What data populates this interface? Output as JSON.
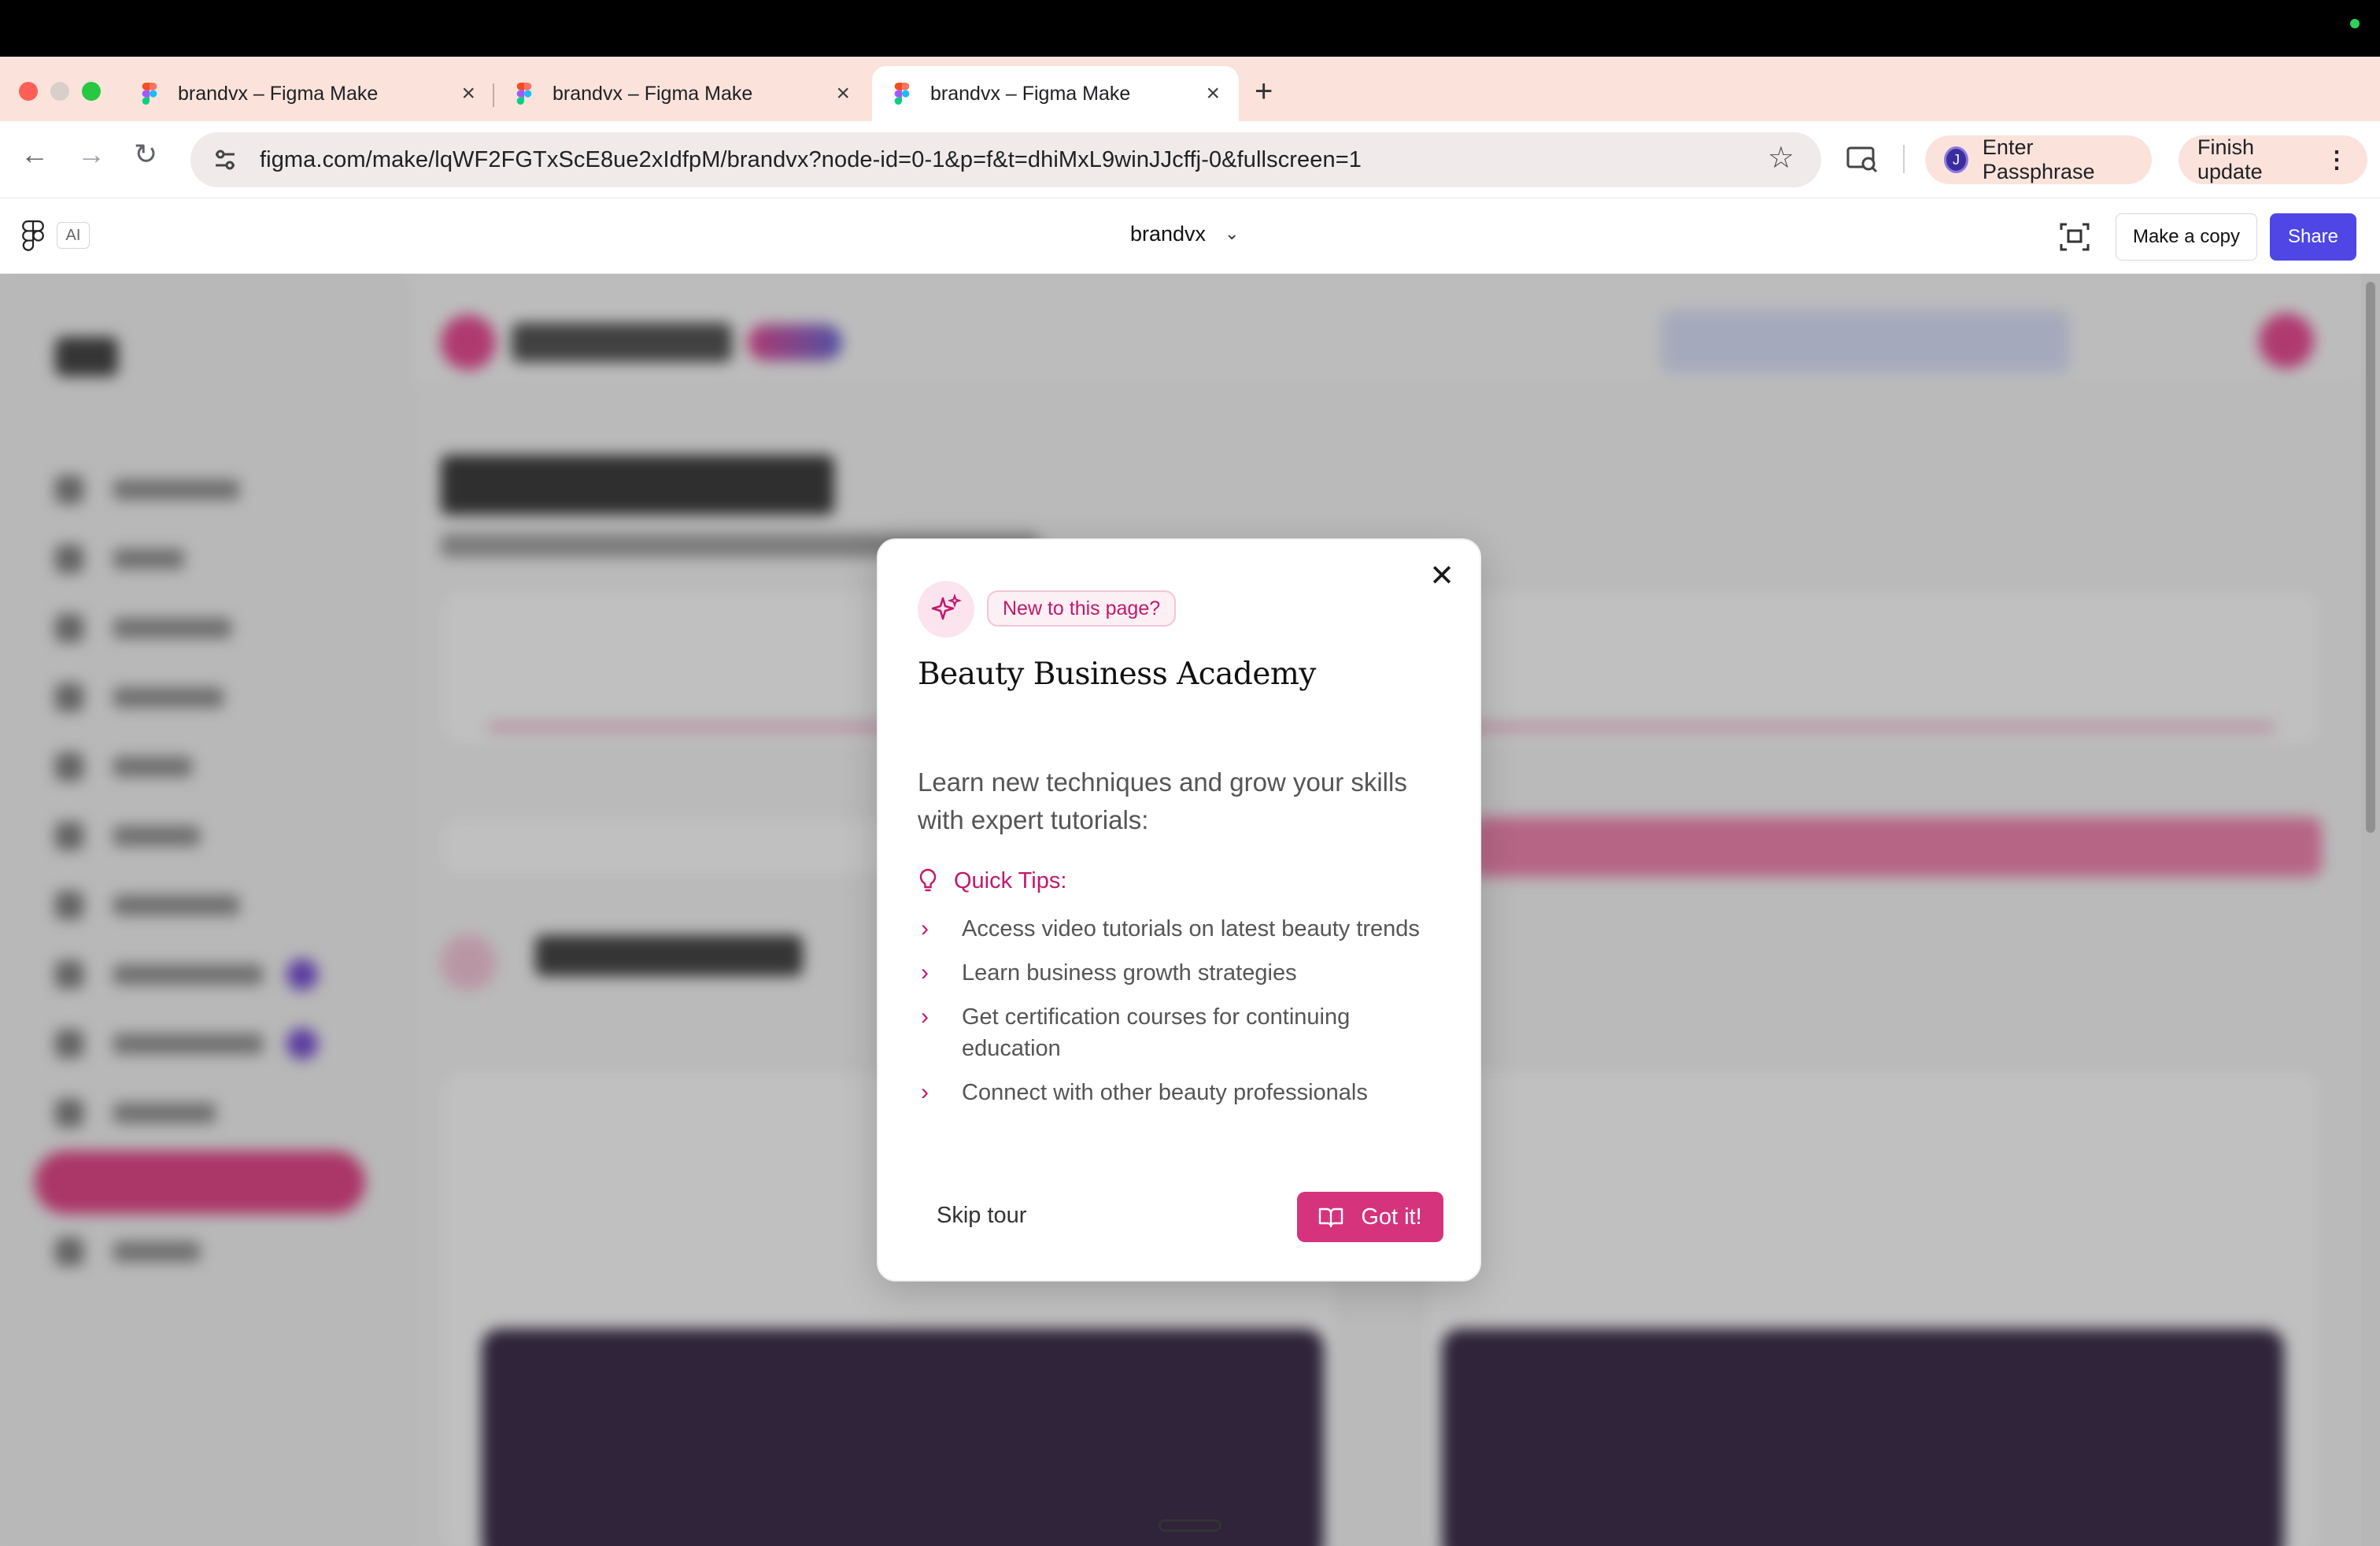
{
  "browser": {
    "tabs": [
      {
        "title": "brandvx – Figma Make"
      },
      {
        "title": "brandvx – Figma Make"
      },
      {
        "title": "brandvx – Figma Make"
      }
    ],
    "url": "figma.com/make/lqWF2FGTxScE8ue2xIdfpM/brandvx?node-id=0-1&p=f&t=dhiMxL9winJJcffj-0&fullscreen=1",
    "profile_initial": "J",
    "passphrase_label": "Enter Passphrase",
    "update_label": "Finish update"
  },
  "figma": {
    "ai_badge": "AI",
    "project_name": "brandvx",
    "make_copy_label": "Make a copy",
    "share_label": "Share"
  },
  "modal": {
    "badge": "New to this page?",
    "title": "Beauty Business Academy",
    "description": "Learn new techniques and grow your skills with expert tutorials:",
    "tips_heading": "Quick Tips:",
    "tips": [
      "Access video tutorials on latest beauty trends",
      "Learn business growth strategies",
      "Get certification courses for continuing education",
      "Connect with other beauty professionals"
    ],
    "skip_label": "Skip tour",
    "confirm_label": "Got it!"
  },
  "colors": {
    "accent_pink": "#d6337d",
    "share_blue": "#4f46e5",
    "chrome_bg": "#fbe3dc"
  }
}
